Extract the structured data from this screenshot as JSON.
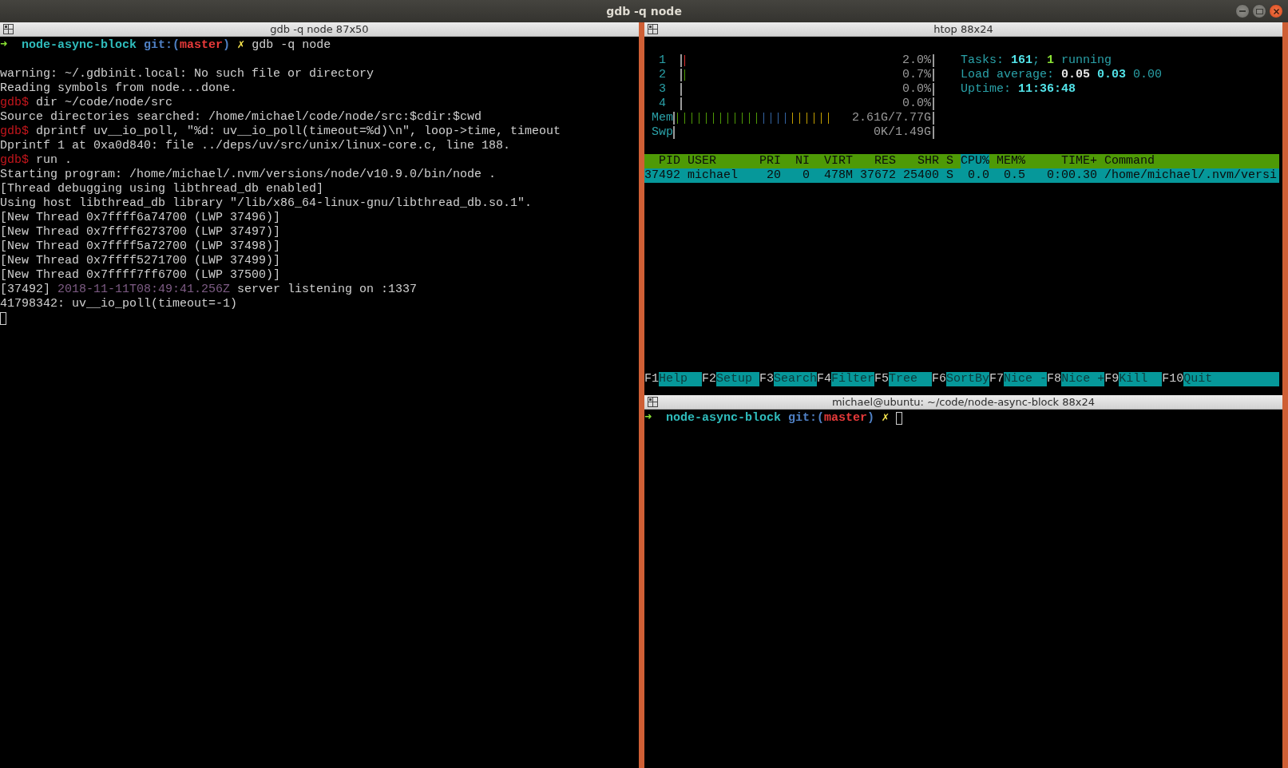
{
  "window": {
    "title": "gdb -q node"
  },
  "gdb_pane": {
    "title": "gdb -q node 87x50",
    "prompt": [
      {
        "kind": "arrow",
        "text": "➜  "
      },
      {
        "kind": "dir",
        "text": "node-async-block "
      },
      {
        "kind": "git",
        "text": "git:("
      },
      {
        "kind": "branch",
        "text": "master"
      },
      {
        "kind": "git",
        "text": ") "
      },
      {
        "kind": "dirty",
        "text": "✗ "
      },
      {
        "kind": "plain",
        "text": "gdb -q node"
      }
    ],
    "lines": [
      [
        {
          "kind": "plain",
          "text": "warning: ~/.gdbinit.local: No such file or directory"
        }
      ],
      [
        {
          "kind": "plain",
          "text": "Reading symbols from node...done."
        }
      ],
      [
        {
          "kind": "gdb",
          "text": "gdb$ "
        },
        {
          "kind": "plain",
          "text": "dir ~/code/node/src"
        }
      ],
      [
        {
          "kind": "plain",
          "text": "Source directories searched: /home/michael/code/node/src:$cdir:$cwd"
        }
      ],
      [
        {
          "kind": "gdb",
          "text": "gdb$ "
        },
        {
          "kind": "plain",
          "text": "dprintf uv__io_poll, \"%d: uv__io_poll(timeout=%d)\\n\", loop->time, timeout"
        }
      ],
      [
        {
          "kind": "plain",
          "text": "Dprintf 1 at 0xa0d840: file ../deps/uv/src/unix/linux-core.c, line 188."
        }
      ],
      [
        {
          "kind": "gdb",
          "text": "gdb$ "
        },
        {
          "kind": "plain",
          "text": "run ."
        }
      ],
      [
        {
          "kind": "plain",
          "text": "Starting program: /home/michael/.nvm/versions/node/v10.9.0/bin/node ."
        }
      ],
      [
        {
          "kind": "plain",
          "text": "[Thread debugging using libthread_db enabled]"
        }
      ],
      [
        {
          "kind": "plain",
          "text": "Using host libthread_db library \"/lib/x86_64-linux-gnu/libthread_db.so.1\"."
        }
      ],
      [
        {
          "kind": "plain",
          "text": "[New Thread 0x7ffff6a74700 (LWP 37496)]"
        }
      ],
      [
        {
          "kind": "plain",
          "text": "[New Thread 0x7ffff6273700 (LWP 37497)]"
        }
      ],
      [
        {
          "kind": "plain",
          "text": "[New Thread 0x7ffff5a72700 (LWP 37498)]"
        }
      ],
      [
        {
          "kind": "plain",
          "text": "[New Thread 0x7ffff5271700 (LWP 37499)]"
        }
      ],
      [
        {
          "kind": "plain",
          "text": "[New Thread 0x7ffff7ff6700 (LWP 37500)]"
        }
      ],
      [
        {
          "kind": "plain",
          "text": "[37492] "
        },
        {
          "kind": "timestamp",
          "text": "2018-11-11T08:49:41.256Z"
        },
        {
          "kind": "plain",
          "text": " server listening on :1337"
        }
      ],
      [
        {
          "kind": "plain",
          "text": "41798342: uv__io_poll(timeout=-1)"
        }
      ]
    ],
    "cursor_visible": true
  },
  "htop_pane": {
    "title": "htop 88x24",
    "meters": [
      {
        "kind": "cpu-kernel",
        "label": "1",
        "level": 0.02,
        "reading": "2.0%"
      },
      {
        "kind": "cpu-user",
        "label": "2",
        "level": 0.01,
        "reading": "0.7%"
      },
      {
        "kind": "cpu-user",
        "label": "3",
        "reading": "0.0%"
      },
      {
        "kind": "cpu-user",
        "label": "4",
        "reading": "0.0%"
      },
      {
        "kind": "memory",
        "label": "Mem",
        "level": 0.63,
        "reading": "2.61G/7.77G"
      },
      {
        "kind": "swap",
        "label": "Swp",
        "reading": "0K/1.49G"
      }
    ],
    "info": [
      [
        {
          "kind": "label",
          "text": "Tasks: "
        },
        {
          "kind": "value",
          "text": "161"
        },
        {
          "kind": "label",
          "text": "; "
        },
        {
          "kind": "good",
          "text": "1"
        },
        {
          "kind": "label",
          "text": " running"
        }
      ],
      [
        {
          "kind": "label",
          "text": "Load average: "
        },
        {
          "kind": "bright",
          "text": "0.05 "
        },
        {
          "kind": "value",
          "text": "0.03 "
        },
        {
          "kind": "label",
          "text": "0.00"
        }
      ],
      [
        {
          "kind": "label",
          "text": "Uptime: "
        },
        {
          "kind": "value",
          "text": "11:36:48"
        }
      ]
    ],
    "columns": [
      {
        "label": "PID",
        "sorted": false
      },
      {
        "label": "USER",
        "sorted": false
      },
      {
        "label": "PRI",
        "sorted": false
      },
      {
        "label": "NI",
        "sorted": false
      },
      {
        "label": "VIRT",
        "sorted": false
      },
      {
        "label": "RES",
        "sorted": false
      },
      {
        "label": "SHR",
        "sorted": false
      },
      {
        "label": "S",
        "sorted": false
      },
      {
        "label": "CPU%",
        "sorted": true
      },
      {
        "label": "MEM%",
        "sorted": false
      },
      {
        "label": "TIME+",
        "sorted": false
      },
      {
        "label": "Command",
        "sorted": false
      }
    ],
    "rows": [
      {
        "selected": true,
        "cells": [
          "37492",
          "michael",
          "20",
          "0",
          "478M",
          "37672",
          "25400",
          "S",
          "0.0",
          "0.5",
          "0:00.30",
          "/home/michael/.nvm/versi"
        ]
      }
    ],
    "function_keys": [
      {
        "key": "F1",
        "label": "Help"
      },
      {
        "key": "F2",
        "label": "Setup"
      },
      {
        "key": "F3",
        "label": "Search"
      },
      {
        "key": "F4",
        "label": "Filter"
      },
      {
        "key": "F5",
        "label": "Tree"
      },
      {
        "key": "F6",
        "label": "SortBy"
      },
      {
        "key": "F7",
        "label": "Nice -"
      },
      {
        "key": "F8",
        "label": "Nice +"
      },
      {
        "key": "F9",
        "label": "Kill"
      },
      {
        "key": "F10",
        "label": "Quit"
      }
    ]
  },
  "shell_pane": {
    "title": "michael@ubuntu: ~/code/node-async-block 88x24",
    "prompt": [
      {
        "kind": "arrow",
        "text": "➜  "
      },
      {
        "kind": "dir",
        "text": "node-async-block "
      },
      {
        "kind": "git",
        "text": "git:("
      },
      {
        "kind": "branch",
        "text": "master"
      },
      {
        "kind": "git",
        "text": ") "
      },
      {
        "kind": "dirty",
        "text": "✗"
      }
    ],
    "cursor_visible": true
  }
}
